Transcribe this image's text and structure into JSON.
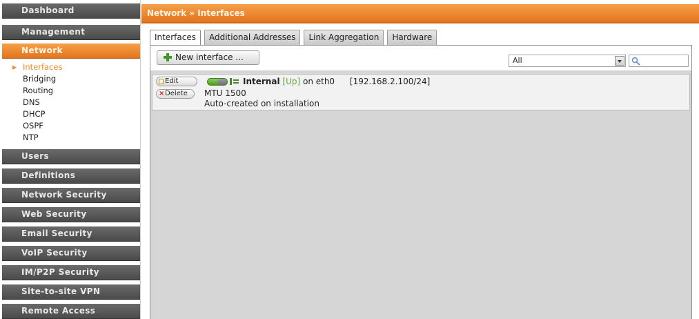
{
  "sidebar": {
    "sections": [
      {
        "label": "Dashboard"
      },
      {
        "label": "Management"
      },
      {
        "label": "Network"
      },
      {
        "label": "Users"
      },
      {
        "label": "Definitions"
      },
      {
        "label": "Network Security"
      },
      {
        "label": "Web Security"
      },
      {
        "label": "Email Security"
      },
      {
        "label": "VoIP Security"
      },
      {
        "label": "IM/P2P Security"
      },
      {
        "label": "Site-to-site VPN"
      },
      {
        "label": "Remote Access"
      }
    ],
    "submenu": [
      {
        "label": "Interfaces"
      },
      {
        "label": "Bridging"
      },
      {
        "label": "Routing"
      },
      {
        "label": "DNS"
      },
      {
        "label": "DHCP"
      },
      {
        "label": "OSPF"
      },
      {
        "label": "NTP"
      }
    ]
  },
  "header": {
    "title": "Network » Interfaces"
  },
  "tabs": [
    {
      "label": "Interfaces"
    },
    {
      "label": "Additional Addresses"
    },
    {
      "label": "Link Aggregation"
    },
    {
      "label": "Hardware"
    }
  ],
  "toolbar": {
    "new_label": "New interface ...",
    "filter_value": "All",
    "search_value": ""
  },
  "interface": {
    "edit_label": "Edit",
    "delete_label": "Delete",
    "name": "Internal",
    "state": "[Up]",
    "on_text": " on eth0",
    "ip": "[192.168.2.100/24]",
    "mtu": "MTU 1500",
    "comment": "Auto-created on installation"
  },
  "colors": {
    "accent_orange": "#e2751e",
    "menu_gray": "#4a4a4a",
    "status_green": "#6aa637",
    "delete_red": "#d11b1b"
  }
}
